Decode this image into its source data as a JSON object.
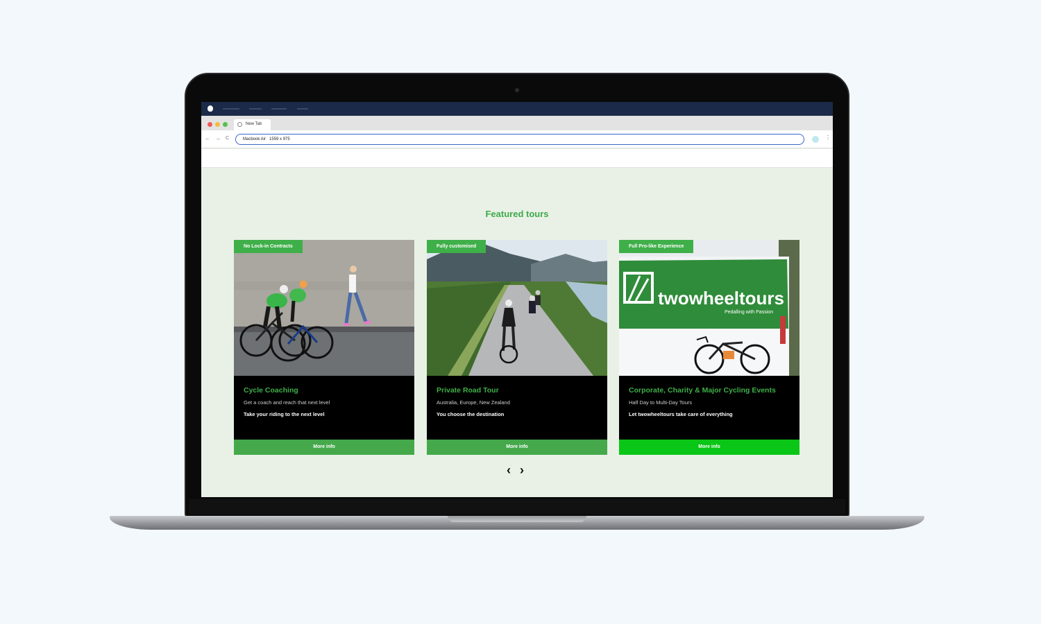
{
  "browser": {
    "tab_title": "New Tab",
    "address": "Macbook Air   1559 x 975",
    "nav_back": "←",
    "nav_forward": "→",
    "nav_reload": "C",
    "menu": "⋮"
  },
  "colors": {
    "accent": "#3faf49",
    "menubar": "#1b2a48",
    "page_bg": "#e9f1e7",
    "button_bright": "#0ac616"
  },
  "section": {
    "title": "Featured tours"
  },
  "cards": [
    {
      "badge": "No Lock-in Contracts",
      "heading": "Cycle Coaching",
      "subtitle": "Get a coach and reach that next level",
      "tagline": "Take your riding to the next level",
      "button": "More info"
    },
    {
      "badge": "Fully customised",
      "heading": "Private Road Tour",
      "subtitle": "Australia, Europe, New Zealand",
      "tagline": "You choose the destination",
      "button": "More info"
    },
    {
      "badge": "Full Pro-like Experience",
      "heading": "Corporate, Charity & Major Cycling Events",
      "subtitle": "Half Day to Multi-Day Tours",
      "tagline": "Let twowheeltours take care of everything",
      "button": "More info",
      "banner_brand": "twowheeltours",
      "banner_slogan": "Pedalling with Passion"
    }
  ],
  "carousel": {
    "prev": "‹",
    "next": "›"
  }
}
